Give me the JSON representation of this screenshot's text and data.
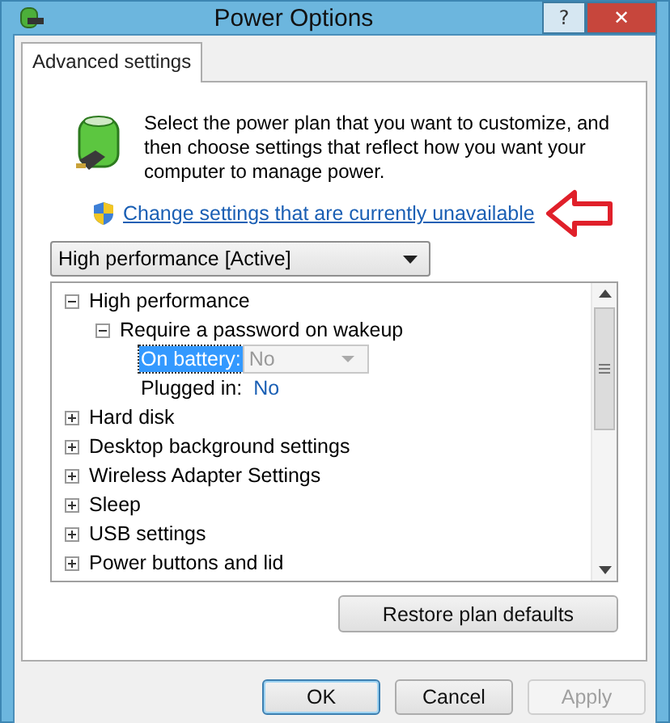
{
  "window": {
    "title": "Power Options",
    "controls": [
      {
        "kind": "help",
        "label": "?"
      },
      {
        "kind": "close",
        "label": "✕"
      }
    ]
  },
  "tabs": [
    {
      "label": "Advanced settings",
      "selected": true
    }
  ],
  "intro": {
    "text": "Select the power plan that you want to customize, and then choose settings that reflect how you want your computer to manage power.",
    "link": "Change settings that are currently unavailable"
  },
  "plan_dropdown": {
    "value": "High performance [Active]"
  },
  "tree": [
    {
      "label": "High performance",
      "expanded": true,
      "children": [
        {
          "label": "Require a password on wakeup",
          "expanded": true,
          "children": [
            {
              "kind": "setting",
              "label": "On battery:",
              "value": "No",
              "selected": true
            },
            {
              "kind": "setting",
              "label": "Plugged in:",
              "value": "No",
              "selected": false
            }
          ]
        }
      ]
    },
    {
      "label": "Hard disk",
      "expanded": false
    },
    {
      "label": "Desktop background settings",
      "expanded": false
    },
    {
      "label": "Wireless Adapter Settings",
      "expanded": false
    },
    {
      "label": "Sleep",
      "expanded": false
    },
    {
      "label": "USB settings",
      "expanded": false
    },
    {
      "label": "Power buttons and lid",
      "expanded": false
    }
  ],
  "restore_button": "Restore plan defaults",
  "buttons": [
    {
      "label": "OK",
      "default": true,
      "disabled": false
    },
    {
      "label": "Cancel",
      "default": false,
      "disabled": false
    },
    {
      "label": "Apply",
      "default": false,
      "disabled": true
    }
  ]
}
